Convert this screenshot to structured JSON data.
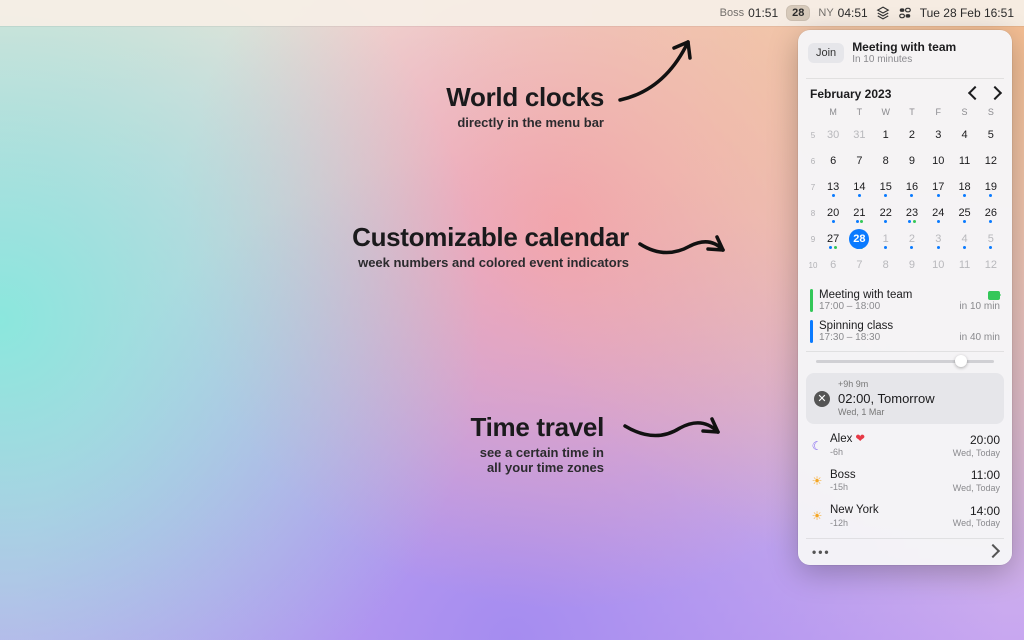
{
  "menubar": {
    "clocks": [
      {
        "label": "Boss",
        "time": "01:51"
      },
      {
        "label": "NY",
        "time": "04:51"
      }
    ],
    "date_pill": "28",
    "system_datetime": "Tue 28 Feb  16:51"
  },
  "panel": {
    "next_event": {
      "join_label": "Join",
      "title": "Meeting with team",
      "subtitle": "In 10 minutes"
    },
    "calendar": {
      "title": "February 2023",
      "dow": [
        "M",
        "T",
        "W",
        "T",
        "F",
        "S",
        "S"
      ],
      "weeks": [
        {
          "wn": "5",
          "days": [
            {
              "n": "30",
              "other": true
            },
            {
              "n": "31",
              "other": true
            },
            {
              "n": "1"
            },
            {
              "n": "2"
            },
            {
              "n": "3"
            },
            {
              "n": "4"
            },
            {
              "n": "5"
            }
          ]
        },
        {
          "wn": "6",
          "days": [
            {
              "n": "6"
            },
            {
              "n": "7"
            },
            {
              "n": "8"
            },
            {
              "n": "9"
            },
            {
              "n": "10"
            },
            {
              "n": "11"
            },
            {
              "n": "12"
            }
          ]
        },
        {
          "wn": "7",
          "days": [
            {
              "n": "13",
              "dots": [
                "b"
              ]
            },
            {
              "n": "14",
              "dots": [
                "b"
              ]
            },
            {
              "n": "15",
              "dots": [
                "b"
              ]
            },
            {
              "n": "16",
              "dots": [
                "b"
              ]
            },
            {
              "n": "17",
              "dots": [
                "b"
              ]
            },
            {
              "n": "18",
              "dots": [
                "b"
              ]
            },
            {
              "n": "19",
              "dots": [
                "b"
              ]
            }
          ]
        },
        {
          "wn": "8",
          "days": [
            {
              "n": "20",
              "dots": [
                "b"
              ]
            },
            {
              "n": "21",
              "dots": [
                "b",
                "g"
              ]
            },
            {
              "n": "22",
              "dots": [
                "b"
              ]
            },
            {
              "n": "23",
              "dots": [
                "b",
                "g"
              ]
            },
            {
              "n": "24",
              "dots": [
                "b"
              ]
            },
            {
              "n": "25",
              "dots": [
                "b"
              ]
            },
            {
              "n": "26",
              "dots": [
                "b"
              ]
            }
          ]
        },
        {
          "wn": "9",
          "days": [
            {
              "n": "27",
              "dots": [
                "b",
                "g"
              ]
            },
            {
              "n": "28",
              "today": true,
              "dots": [
                "b",
                "g"
              ]
            },
            {
              "n": "1",
              "other": true,
              "dots": [
                "b"
              ]
            },
            {
              "n": "2",
              "other": true,
              "dots": [
                "b"
              ]
            },
            {
              "n": "3",
              "other": true,
              "dots": [
                "b"
              ]
            },
            {
              "n": "4",
              "other": true,
              "dots": [
                "b"
              ]
            },
            {
              "n": "5",
              "other": true,
              "dots": [
                "b"
              ]
            }
          ]
        },
        {
          "wn": "10",
          "days": [
            {
              "n": "6",
              "other": true
            },
            {
              "n": "7",
              "other": true
            },
            {
              "n": "8",
              "other": true
            },
            {
              "n": "9",
              "other": true
            },
            {
              "n": "10",
              "other": true
            },
            {
              "n": "11",
              "other": true
            },
            {
              "n": "12",
              "other": true
            }
          ]
        }
      ]
    },
    "events": [
      {
        "title": "Meeting with team",
        "time": "17:00 – 18:00",
        "rel": "in 10 min",
        "color": "#34c759",
        "video": true
      },
      {
        "title": "Spinning class",
        "time": "17:30 – 18:30",
        "rel": "in 40 min",
        "color": "#0a7aff",
        "video": false
      }
    ],
    "time_travel": {
      "slider_pos": "78%",
      "offset": "+9h 9m",
      "time": "02:00, Tomorrow",
      "date": "Wed, 1 Mar"
    },
    "timezones": [
      {
        "icon": "moon",
        "name": "Alex",
        "heart": true,
        "offset": "-6h",
        "time": "20:00",
        "day": "Wed, Today"
      },
      {
        "icon": "sun",
        "name": "Boss",
        "heart": false,
        "offset": "-15h",
        "time": "11:00",
        "day": "Wed, Today"
      },
      {
        "icon": "sun",
        "name": "New York",
        "heart": false,
        "offset": "-12h",
        "time": "14:00",
        "day": "Wed, Today"
      }
    ]
  },
  "promos": [
    {
      "title": "World clocks",
      "sub": "directly in the menu bar"
    },
    {
      "title": "Customizable calendar",
      "sub": "week numbers and colored event indicators"
    },
    {
      "title": "Time travel",
      "sub": "see a certain time in\nall your time zones"
    }
  ]
}
